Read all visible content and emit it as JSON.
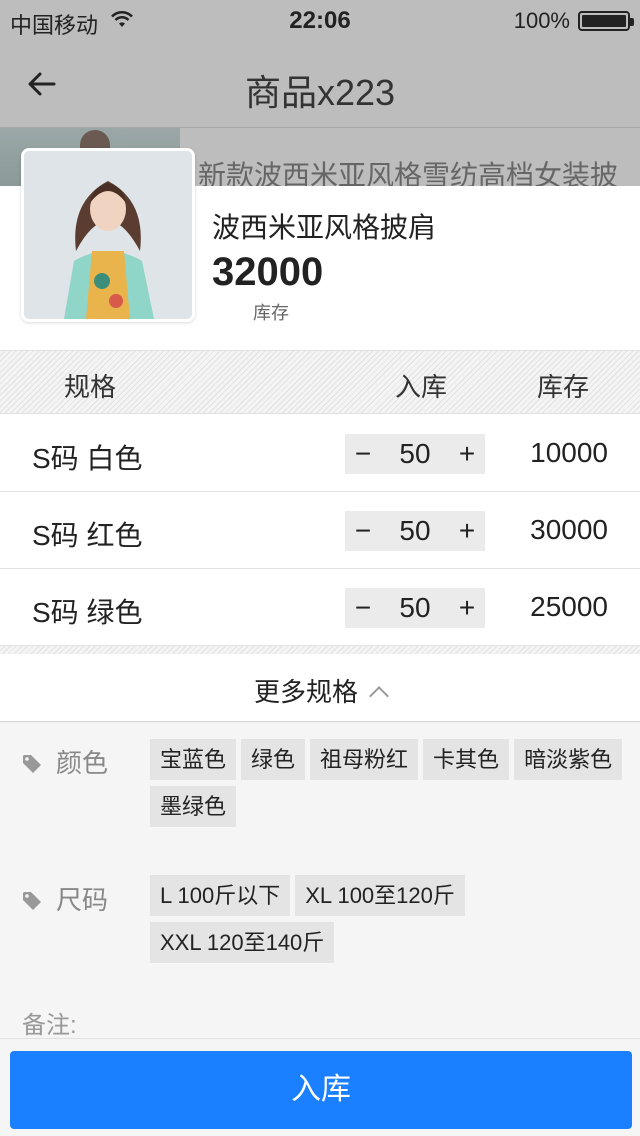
{
  "status_bar": {
    "carrier": "中国移动",
    "time": "22:06",
    "battery": "100%"
  },
  "nav": {
    "title": "商品x223",
    "back_icon": "arrow-left-icon"
  },
  "behind": {
    "product_title": "新款波西米亚风格雪纺高档女装披"
  },
  "product": {
    "name": "波西米亚风格披肩",
    "stock": "32000",
    "stock_label": "库存"
  },
  "table": {
    "headers": {
      "spec": "规格",
      "in": "入库",
      "stock": "库存"
    },
    "rows": [
      {
        "spec": "S码 白色",
        "qty": "50",
        "stock": "10000"
      },
      {
        "spec": "S码 红色",
        "qty": "50",
        "stock": "30000"
      },
      {
        "spec": "S码 绿色",
        "qty": "50",
        "stock": "25000"
      }
    ],
    "minus": "−",
    "plus": "+"
  },
  "more": {
    "label": "更多规格"
  },
  "options": {
    "color": {
      "label": "颜色",
      "chips": [
        "宝蓝色",
        "绿色",
        "祖母粉红",
        "卡其色",
        "暗淡紫色",
        "墨绿色"
      ]
    },
    "size": {
      "label": "尺码",
      "chips": [
        "L 100斤以下",
        "XL 100至120斤",
        "XXL 120至140斤"
      ]
    }
  },
  "remark_label": "备注:",
  "submit_label": "入库",
  "colors": {
    "accent": "#1a80ff",
    "overlay": "#bdbdbd"
  }
}
